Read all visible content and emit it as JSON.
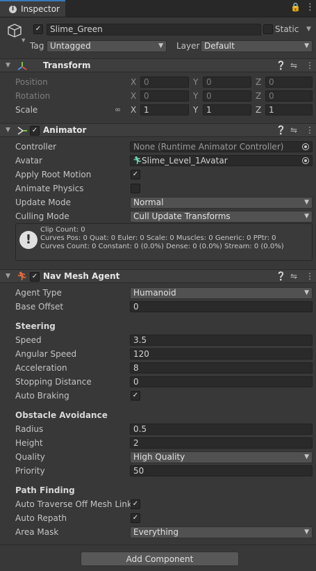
{
  "window": {
    "tab_label": "Inspector",
    "menu_icon": "⋮",
    "lock_icon": "🔒"
  },
  "gameobject": {
    "name": "Slime_Green",
    "active": true,
    "static_label": "Static",
    "static": false,
    "tag_label": "Tag",
    "tag_value": "Untagged",
    "layer_label": "Layer",
    "layer_value": "Default"
  },
  "transform": {
    "title": "Transform",
    "rows": [
      {
        "label": "Position",
        "x": "0",
        "y": "0",
        "z": "0",
        "dim": true
      },
      {
        "label": "Rotation",
        "x": "0",
        "y": "0",
        "z": "0",
        "dim": true
      },
      {
        "label": "Scale",
        "x": "1",
        "y": "1",
        "z": "1",
        "dim": false
      }
    ],
    "axis_x": "X",
    "axis_y": "Y",
    "axis_z": "Z"
  },
  "animator": {
    "title": "Animator",
    "enabled": true,
    "controller_label": "Controller",
    "controller_value": "None (Runtime Animator Controller)",
    "avatar_label": "Avatar",
    "avatar_value": "Slime_Level_1Avatar",
    "apply_root_motion_label": "Apply Root Motion",
    "apply_root_motion": true,
    "animate_physics_label": "Animate Physics",
    "animate_physics": false,
    "update_mode_label": "Update Mode",
    "update_mode_value": "Normal",
    "culling_mode_label": "Culling Mode",
    "culling_mode_value": "Cull Update Transforms",
    "info_lines": [
      "Clip Count: 0",
      "Curves Pos: 0 Quat: 0 Euler: 0 Scale: 0 Muscles: 0 Generic: 0 PPtr: 0",
      "Curves Count: 0 Constant: 0 (0.0%) Dense: 0 (0.0%) Stream: 0 (0.0%)"
    ]
  },
  "navmesh": {
    "title": "Nav Mesh Agent",
    "enabled": true,
    "agent_type_label": "Agent Type",
    "agent_type_value": "Humanoid",
    "base_offset_label": "Base Offset",
    "base_offset_value": "0",
    "steering_header": "Steering",
    "speed_label": "Speed",
    "speed_value": "3.5",
    "angular_speed_label": "Angular Speed",
    "angular_speed_value": "120",
    "acceleration_label": "Acceleration",
    "acceleration_value": "8",
    "stopping_distance_label": "Stopping Distance",
    "stopping_distance_value": "0",
    "auto_braking_label": "Auto Braking",
    "auto_braking": true,
    "obstacle_header": "Obstacle Avoidance",
    "radius_label": "Radius",
    "radius_value": "0.5",
    "height_label": "Height",
    "height_value": "2",
    "quality_label": "Quality",
    "quality_value": "High Quality",
    "priority_label": "Priority",
    "priority_value": "50",
    "pathfinding_header": "Path Finding",
    "auto_traverse_label": "Auto Traverse Off Mesh Link",
    "auto_traverse": true,
    "auto_repath_label": "Auto Repath",
    "auto_repath": true,
    "area_mask_label": "Area Mask",
    "area_mask_value": "Everything"
  },
  "add_component_label": "Add Component",
  "colors": {
    "accent": "#3a79bb",
    "panel": "#383838",
    "field": "#2a2a2a"
  }
}
